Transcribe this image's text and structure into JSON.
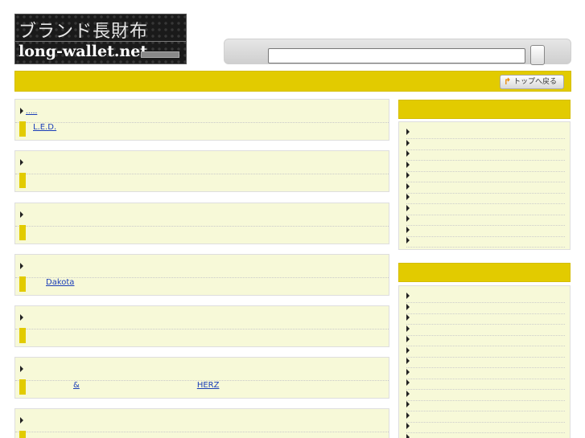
{
  "header": {
    "logo_text_top": "ブランド長財布",
    "logo_text_bottom": "long-wallet.net",
    "top_button_label": "トップへ戻る"
  },
  "main": {
    "blocks": [
      {
        "title": ".....",
        "links": [
          "L.E.D.",
          "",
          "",
          "",
          "",
          "",
          "",
          "",
          ""
        ]
      },
      {
        "title": "",
        "links": [
          "",
          "",
          "",
          "",
          "",
          "",
          "",
          ""
        ]
      },
      {
        "title": "",
        "links": [
          "",
          "",
          "",
          "",
          "",
          "",
          ""
        ]
      },
      {
        "title": "",
        "links": [
          "",
          "Dakota",
          "",
          ""
        ]
      },
      {
        "title": "",
        "links": [
          "",
          ""
        ]
      },
      {
        "title": "",
        "links": [
          "",
          "",
          "&",
          "",
          "",
          "",
          "",
          "",
          "",
          "",
          "",
          "HERZ",
          "",
          "",
          "",
          "",
          ""
        ]
      },
      {
        "title": "",
        "links": []
      }
    ]
  },
  "sidebar": {
    "section1_items": [
      "",
      "",
      "",
      "",
      "",
      "",
      "",
      "",
      "",
      "",
      ""
    ],
    "section2_items": [
      "",
      "",
      "",
      "",
      "",
      "",
      "",
      "",
      "",
      "",
      "",
      "",
      "",
      ""
    ]
  }
}
